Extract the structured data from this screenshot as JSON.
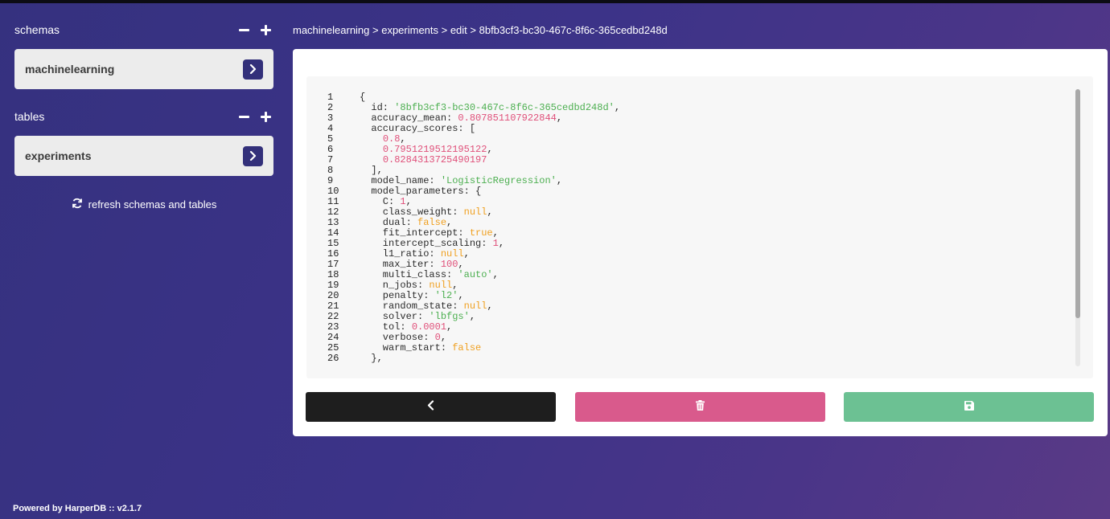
{
  "sidebar": {
    "schemas_title": "schemas",
    "schema_item": "machinelearning",
    "tables_title": "tables",
    "table_item": "experiments",
    "refresh_label": "refresh schemas and tables"
  },
  "breadcrumb": "machinelearning > experiments > edit > 8bfb3cf3-bc30-467c-8f6c-365cedbd248d",
  "editor": {
    "lines": [
      {
        "n": "1",
        "parts": [
          {
            "t": "{",
            "c": ""
          }
        ]
      },
      {
        "n": "2",
        "parts": [
          {
            "t": "  id: ",
            "c": ""
          },
          {
            "t": "'8bfb3cf3-bc30-467c-8f6c-365cedbd248d'",
            "c": "s"
          },
          {
            "t": ",",
            "c": ""
          }
        ]
      },
      {
        "n": "3",
        "parts": [
          {
            "t": "  accuracy_mean: ",
            "c": ""
          },
          {
            "t": "0.807851107922844",
            "c": "n"
          },
          {
            "t": ",",
            "c": ""
          }
        ]
      },
      {
        "n": "4",
        "parts": [
          {
            "t": "  accuracy_scores: [",
            "c": ""
          }
        ]
      },
      {
        "n": "5",
        "parts": [
          {
            "t": "    ",
            "c": ""
          },
          {
            "t": "0.8",
            "c": "n"
          },
          {
            "t": ",",
            "c": ""
          }
        ]
      },
      {
        "n": "6",
        "parts": [
          {
            "t": "    ",
            "c": ""
          },
          {
            "t": "0.7951219512195122",
            "c": "n"
          },
          {
            "t": ",",
            "c": ""
          }
        ]
      },
      {
        "n": "7",
        "parts": [
          {
            "t": "    ",
            "c": ""
          },
          {
            "t": "0.8284313725490197",
            "c": "n"
          }
        ]
      },
      {
        "n": "8",
        "parts": [
          {
            "t": "  ],",
            "c": ""
          }
        ]
      },
      {
        "n": "9",
        "parts": [
          {
            "t": "  model_name: ",
            "c": ""
          },
          {
            "t": "'LogisticRegression'",
            "c": "s"
          },
          {
            "t": ",",
            "c": ""
          }
        ]
      },
      {
        "n": "10",
        "parts": [
          {
            "t": "  model_parameters: {",
            "c": ""
          }
        ]
      },
      {
        "n": "11",
        "parts": [
          {
            "t": "    C: ",
            "c": ""
          },
          {
            "t": "1",
            "c": "n"
          },
          {
            "t": ",",
            "c": ""
          }
        ]
      },
      {
        "n": "12",
        "parts": [
          {
            "t": "    class_weight: ",
            "c": ""
          },
          {
            "t": "null",
            "c": "k"
          },
          {
            "t": ",",
            "c": ""
          }
        ]
      },
      {
        "n": "13",
        "parts": [
          {
            "t": "    dual: ",
            "c": ""
          },
          {
            "t": "false",
            "c": "k"
          },
          {
            "t": ",",
            "c": ""
          }
        ]
      },
      {
        "n": "14",
        "parts": [
          {
            "t": "    fit_intercept: ",
            "c": ""
          },
          {
            "t": "true",
            "c": "k"
          },
          {
            "t": ",",
            "c": ""
          }
        ]
      },
      {
        "n": "15",
        "parts": [
          {
            "t": "    intercept_scaling: ",
            "c": ""
          },
          {
            "t": "1",
            "c": "n"
          },
          {
            "t": ",",
            "c": ""
          }
        ]
      },
      {
        "n": "16",
        "parts": [
          {
            "t": "    l1_ratio: ",
            "c": ""
          },
          {
            "t": "null",
            "c": "k"
          },
          {
            "t": ",",
            "c": ""
          }
        ]
      },
      {
        "n": "17",
        "parts": [
          {
            "t": "    max_iter: ",
            "c": ""
          },
          {
            "t": "100",
            "c": "n"
          },
          {
            "t": ",",
            "c": ""
          }
        ]
      },
      {
        "n": "18",
        "parts": [
          {
            "t": "    multi_class: ",
            "c": ""
          },
          {
            "t": "'auto'",
            "c": "s"
          },
          {
            "t": ",",
            "c": ""
          }
        ]
      },
      {
        "n": "19",
        "parts": [
          {
            "t": "    n_jobs: ",
            "c": ""
          },
          {
            "t": "null",
            "c": "k"
          },
          {
            "t": ",",
            "c": ""
          }
        ]
      },
      {
        "n": "20",
        "parts": [
          {
            "t": "    penalty: ",
            "c": ""
          },
          {
            "t": "'l2'",
            "c": "s"
          },
          {
            "t": ",",
            "c": ""
          }
        ]
      },
      {
        "n": "21",
        "parts": [
          {
            "t": "    random_state: ",
            "c": ""
          },
          {
            "t": "null",
            "c": "k"
          },
          {
            "t": ",",
            "c": ""
          }
        ]
      },
      {
        "n": "22",
        "parts": [
          {
            "t": "    solver: ",
            "c": ""
          },
          {
            "t": "'lbfgs'",
            "c": "s"
          },
          {
            "t": ",",
            "c": ""
          }
        ]
      },
      {
        "n": "23",
        "parts": [
          {
            "t": "    tol: ",
            "c": ""
          },
          {
            "t": "0.0001",
            "c": "n"
          },
          {
            "t": ",",
            "c": ""
          }
        ]
      },
      {
        "n": "24",
        "parts": [
          {
            "t": "    verbose: ",
            "c": ""
          },
          {
            "t": "0",
            "c": "n"
          },
          {
            "t": ",",
            "c": ""
          }
        ]
      },
      {
        "n": "25",
        "parts": [
          {
            "t": "    warm_start: ",
            "c": ""
          },
          {
            "t": "false",
            "c": "k"
          }
        ]
      },
      {
        "n": "26",
        "parts": [
          {
            "t": "  },",
            "c": ""
          }
        ]
      }
    ]
  },
  "buttons": {
    "back_icon": "chevron-left-icon",
    "delete_icon": "trash-icon",
    "save_icon": "floppy-disk-icon"
  },
  "colors": {
    "back": "#1e1e1e",
    "delete": "#d95a8c",
    "save": "#6cc193",
    "accent": "#33307a"
  },
  "footer": "Powered by HarperDB :: v2.1.7"
}
